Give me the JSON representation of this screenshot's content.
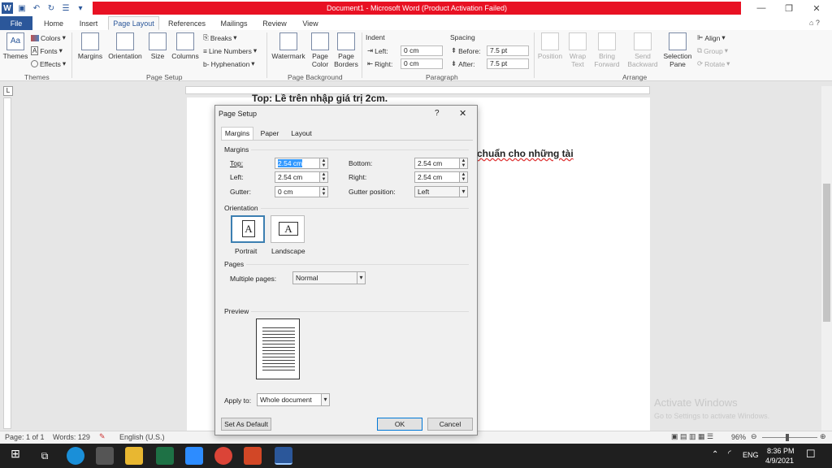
{
  "window": {
    "title": "Document1 - Microsoft Word (Product Activation Failed)"
  },
  "tabs": [
    "File",
    "Home",
    "Insert",
    "Page Layout",
    "References",
    "Mailings",
    "Review",
    "View"
  ],
  "ribbon": {
    "themes": {
      "themes_label": "Themes",
      "colors": "Colors",
      "fonts": "Fonts",
      "effects": "Effects",
      "group": "Themes"
    },
    "page_setup": {
      "margins": "Margins",
      "orientation": "Orientation",
      "size": "Size",
      "columns": "Columns",
      "breaks": "Breaks",
      "line_numbers": "Line Numbers",
      "hyphenation": "Hyphenation",
      "group": "Page Setup"
    },
    "page_background": {
      "watermark": "Watermark",
      "page_color_1": "Page",
      "page_color_2": "Color",
      "page_borders_1": "Page",
      "page_borders_2": "Borders",
      "group": "Page Background"
    },
    "paragraph": {
      "indent": "Indent",
      "left": "Left:",
      "right": "Right:",
      "left_val": "0 cm",
      "right_val": "0 cm",
      "spacing": "Spacing",
      "before": "Before:",
      "after": "After:",
      "before_val": "7.5 pt",
      "after_val": "7.5 pt",
      "group": "Paragraph"
    },
    "arrange": {
      "position": "Position",
      "wrap_1": "Wrap",
      "wrap_2": "Text",
      "bring_1": "Bring",
      "bring_2": "Forward",
      "send_1": "Send",
      "send_2": "Backward",
      "sel_1": "Selection",
      "sel_2": "Pane",
      "align": "Align",
      "group_btn": "Group",
      "rotate": "Rotate",
      "group": "Arrange"
    }
  },
  "document": {
    "line_top": "Top: Lề trên nhập giá trị 2cm.",
    "line_mid": "chuẩn cho những tài"
  },
  "watermark": {
    "line1": "Activate Windows",
    "line2": "Go to Settings to activate Windows."
  },
  "status": {
    "page": "Page: 1 of 1",
    "words": "Words: 129",
    "language": "English (U.S.)",
    "zoom": "96%"
  },
  "taskbar": {
    "language": "ENG",
    "time": "8:36 PM",
    "date": "4/9/2021"
  },
  "dialog": {
    "title": "Page Setup",
    "help": "?",
    "close": "✕",
    "tabs": [
      "Margins",
      "Paper",
      "Layout"
    ],
    "margins_section": "Margins",
    "top_label": "Top:",
    "top_value": "2.54 cm",
    "bottom_label": "Bottom:",
    "bottom_value": "2.54 cm",
    "left_label": "Left:",
    "left_value": "2.54 cm",
    "right_label": "Right:",
    "right_value": "2.54 cm",
    "gutter_label": "Gutter:",
    "gutter_value": "0 cm",
    "gutter_pos_label": "Gutter position:",
    "gutter_pos_value": "Left",
    "orientation_section": "Orientation",
    "portrait": "Portrait",
    "landscape": "Landscape",
    "pages_section": "Pages",
    "multiple_pages_label": "Multiple pages:",
    "multiple_pages_value": "Normal",
    "preview_section": "Preview",
    "apply_to_label": "Apply to:",
    "apply_to_value": "Whole document",
    "set_default": "Set As Default",
    "ok": "OK",
    "cancel": "Cancel"
  },
  "colors": {
    "accent": "#2b579a",
    "alert": "#e81123"
  }
}
